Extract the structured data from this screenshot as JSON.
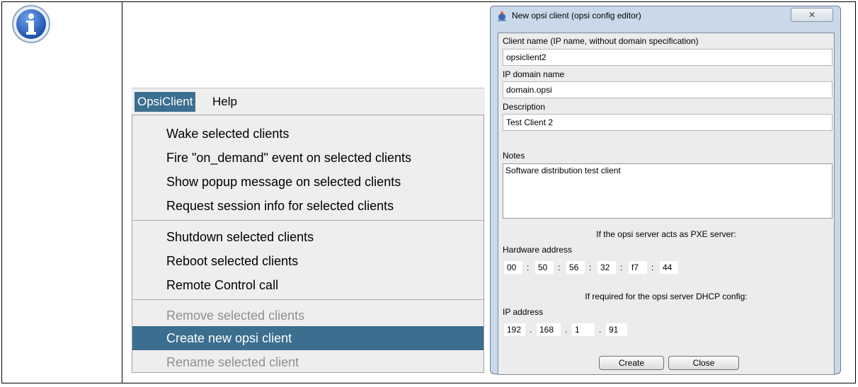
{
  "menu": {
    "titles": [
      "OpsiClient",
      "Help"
    ],
    "items": [
      {
        "label": "Wake selected clients"
      },
      {
        "label": "Fire \"on_demand\" event on selected clients"
      },
      {
        "label": "Show popup message on selected clients"
      },
      {
        "label": "Request session info for selected clients"
      },
      {
        "label": "Shutdown selected clients"
      },
      {
        "label": "Reboot selected clients"
      },
      {
        "label": "Remote Control call"
      },
      {
        "label": "Remove selected clients"
      },
      {
        "label": "Create new opsi client"
      },
      {
        "label": "Rename selected client"
      }
    ]
  },
  "dialog": {
    "title": "New opsi client (opsi config editor)",
    "close_glyph": "✕",
    "client_name_label": "Client name (IP name, without domain specification)",
    "client_name_value": "opsiclient2",
    "domain_label": "IP domain name",
    "domain_value": "domain.opsi",
    "description_label": "Description",
    "description_value": "Test Client 2",
    "notes_label": "Notes",
    "notes_value": "Software distribution  test client",
    "pxe_note": "If the opsi server acts as PXE server:",
    "hw_label": "Hardware address",
    "hw_segments": [
      "00",
      "50",
      "56",
      "32",
      "f7",
      "44"
    ],
    "dhcp_note": "If required for the opsi server DHCP config:",
    "ip_label": "IP address",
    "ip_segments": [
      "192",
      "168",
      "1",
      "91"
    ],
    "create_label": "Create",
    "close_label": "Close"
  },
  "colors": {
    "selection": "#3b6e8f",
    "dialog_frame": "#c9d9ea"
  },
  "icons": [
    "info-icon",
    "opsi-app-icon",
    "window-close-icon"
  ]
}
